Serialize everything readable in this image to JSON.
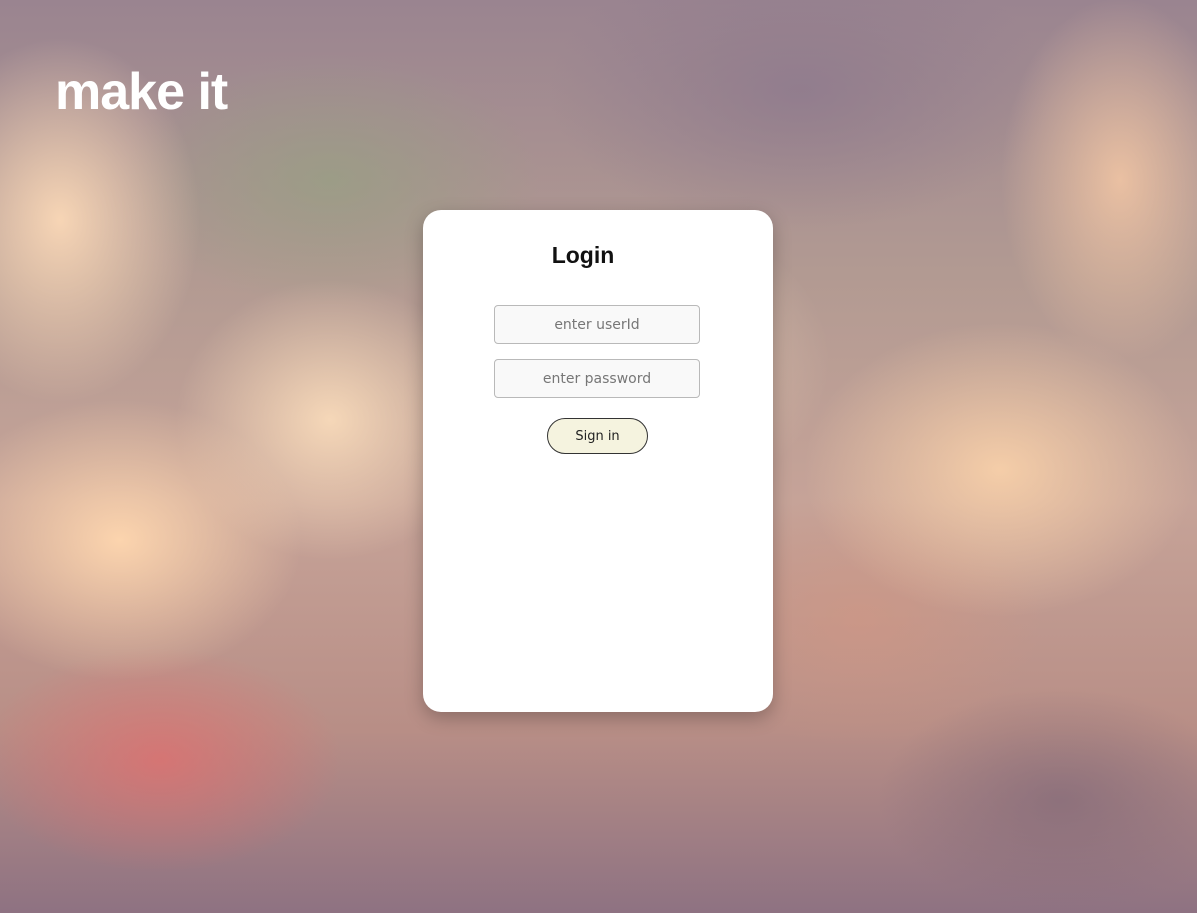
{
  "brand": {
    "logo_text": "make it"
  },
  "login": {
    "title": "Login",
    "user_id_placeholder": "enter userId",
    "password_placeholder": "enter password",
    "signin_label": "Sign in"
  },
  "colors": {
    "card_background": "#ffffff",
    "signin_background": "#f5f3df",
    "signin_border": "#333333",
    "brand_text": "#ffffff"
  }
}
